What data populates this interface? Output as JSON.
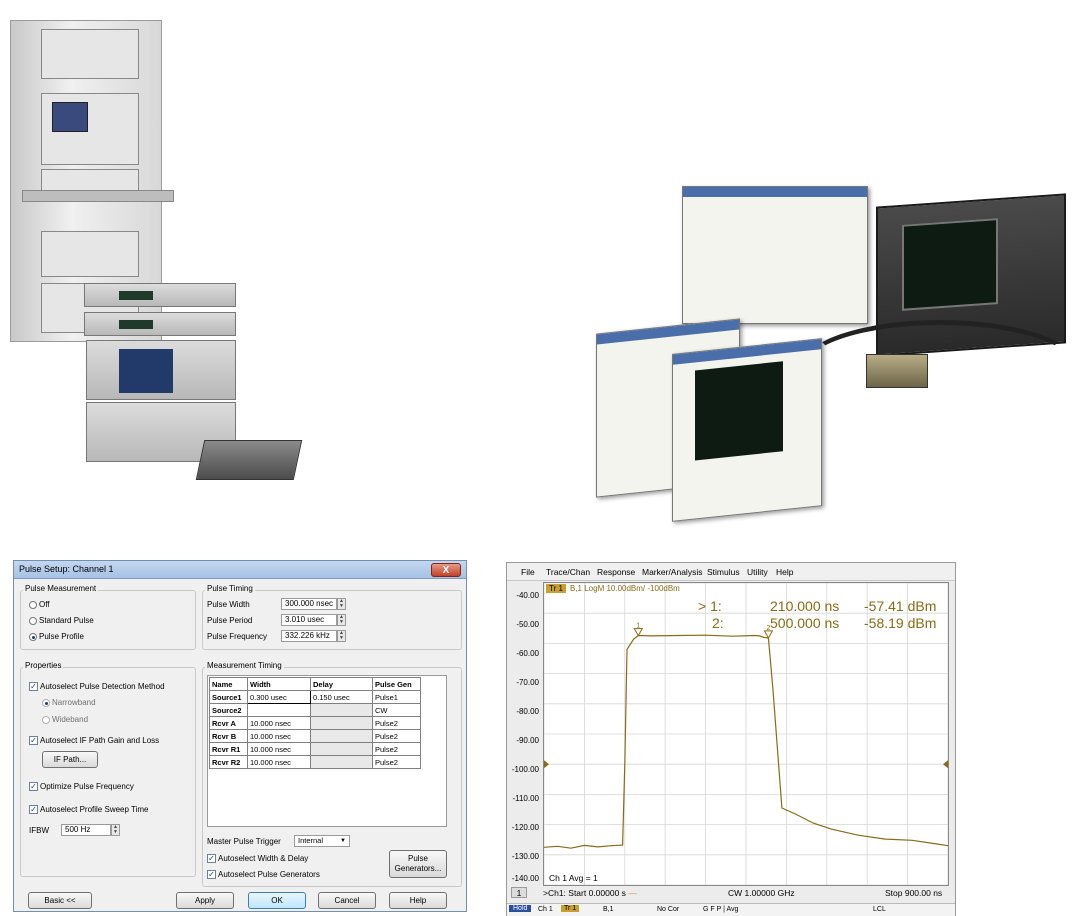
{
  "colors": {
    "trace": "#8a6a14",
    "grid": "#d6d6d6",
    "dialog_title": "#a6c2e6",
    "close": "#c24128"
  },
  "dialog": {
    "title": "Pulse Setup: Channel 1",
    "close_glyph": "X",
    "pulse_measurement": {
      "label": "Pulse Measurement",
      "options": [
        "Off",
        "Standard Pulse",
        "Pulse Profile"
      ],
      "selected": "Pulse Profile"
    },
    "pulse_timing": {
      "label": "Pulse Timing",
      "width_label": "Pulse Width",
      "width_value": "300.000 nsec",
      "period_label": "Pulse Period",
      "period_value": "3.010 usec",
      "freq_label": "Pulse Frequency",
      "freq_value": "332.226 kHz"
    },
    "properties": {
      "label": "Properties",
      "autoselect_detection": "Autoselect Pulse Detection Method",
      "narrowband": "Narrowband",
      "wideband": "Wideband",
      "autoselect_if": "Autoselect IF Path Gain and Loss",
      "if_path_button": "IF Path...",
      "optimize_freq": "Optimize Pulse Frequency",
      "autoselect_sweep": "Autoselect Profile Sweep Time",
      "ifbw_label": "IFBW",
      "ifbw_value": "500 Hz"
    },
    "measurement_timing": {
      "label": "Measurement Timing",
      "headers": [
        "Name",
        "Width",
        "Delay",
        "Pulse Gen"
      ],
      "rows": [
        [
          "Source1",
          "0.300 usec",
          "0.150 usec",
          "Pulse1"
        ],
        [
          "Source2",
          "",
          "",
          "CW"
        ],
        [
          "Rcvr A",
          "10.000 nsec",
          "",
          "Pulse2"
        ],
        [
          "Rcvr B",
          "10.000 nsec",
          "",
          "Pulse2"
        ],
        [
          "Rcvr R1",
          "10.000 nsec",
          "",
          "Pulse2"
        ],
        [
          "Rcvr R2",
          "10.000 nsec",
          "",
          "Pulse2"
        ]
      ]
    },
    "master_trigger_label": "Master Pulse Trigger",
    "master_trigger_value": "Internal",
    "autoselect_width_delay": "Autoselect Width & Delay",
    "autoselect_generators": "Autoselect Pulse Generators",
    "pulse_generators_button": [
      "Pulse",
      "Generators..."
    ],
    "buttons": {
      "basic": "Basic <<",
      "apply": "Apply",
      "ok": "OK",
      "cancel": "Cancel",
      "help": "Help"
    }
  },
  "analyzer": {
    "menu": [
      "File",
      "Trace/Chan",
      "Response",
      "Marker/Analysis",
      "Stimulus",
      "Utility",
      "Help"
    ],
    "trace_badge": "Tr 1",
    "trace_desc": "B,1 LogM 10.00dBm/  -100dBm",
    "markers": [
      {
        "label": "> 1:",
        "x": "210.000 ns",
        "y": "-57.41 dBm"
      },
      {
        "label": "2:",
        "x": "500.000 ns",
        "y": "-58.19 dBm"
      }
    ],
    "marker_tags": [
      "1",
      "2"
    ],
    "ch_avg": "Ch 1 Avg =   1",
    "channel_num": "1",
    "start": ">Ch1:  Start 0.00000 s",
    "cw": "CW  1.00000 GHz",
    "stop": "Stop  900.00 ns",
    "status": [
      "Hold",
      "Ch 1",
      "Tr 1",
      "B,1",
      "No Cor",
      "G F P | Avg",
      "LCL"
    ]
  },
  "chart_data": {
    "type": "line",
    "title": "",
    "xlabel": "",
    "ylabel": "",
    "xlim": [
      0,
      900
    ],
    "ylim": [
      -140,
      -40
    ],
    "y_ticks": [
      "-40.00",
      "-50.00",
      "-60.00",
      "-70.00",
      "-80.00",
      "-90.00",
      "-100.00",
      "-110.00",
      "-120.00",
      "-130.00",
      "-140.00"
    ],
    "grid": true,
    "series": [
      {
        "x": [
          0,
          30,
          60,
          90,
          120,
          150,
          175,
          180,
          185,
          200,
          210,
          240,
          300,
          360,
          420,
          470,
          480,
          490,
          500,
          510,
          530,
          560,
          600,
          640,
          700,
          760,
          820,
          870,
          900
        ],
        "y": [
          -127.5,
          -127.2,
          -127.8,
          -126.9,
          -127.4,
          -127.0,
          -126.8,
          -100,
          -62,
          -58.5,
          -57.4,
          -57.5,
          -57.4,
          -57.3,
          -57.6,
          -57.4,
          -57.5,
          -58.0,
          -58.2,
          -75,
          -114.5,
          -116.5,
          -119.5,
          -121.5,
          -123.5,
          -124.8,
          -125.2,
          -126.3,
          -127.0
        ]
      }
    ]
  }
}
